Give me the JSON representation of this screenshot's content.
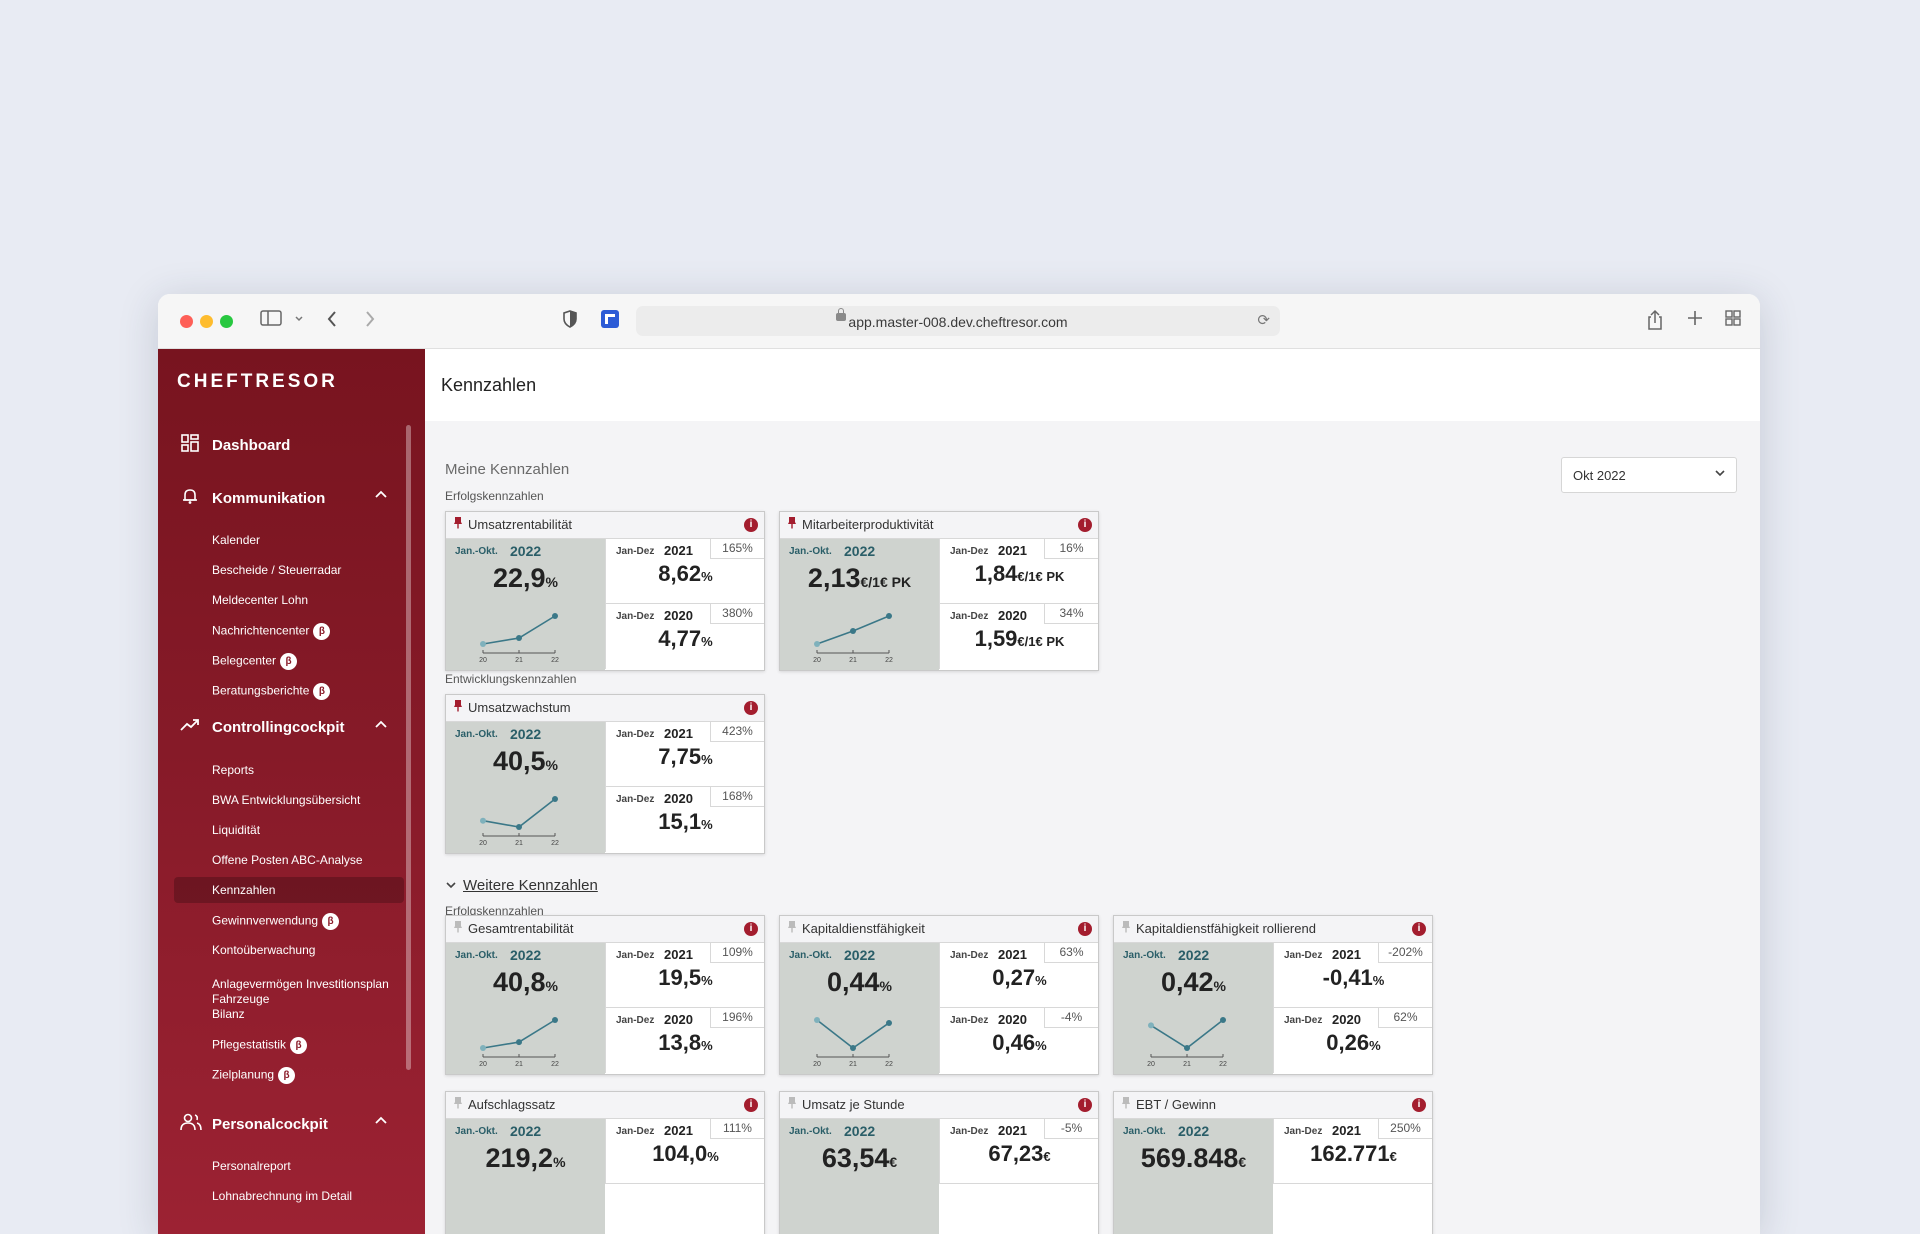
{
  "browser": {
    "url": "app.master-008.dev.cheftresor.com"
  },
  "sidebar": {
    "logo": "CHEFTRESOR",
    "dashboard": "Dashboard",
    "sections": [
      {
        "label": "Kommunikation",
        "items": [
          {
            "label": "Kalender"
          },
          {
            "label": "Bescheide / Steuerradar"
          },
          {
            "label": "Meldecenter Lohn"
          },
          {
            "label": "Nachrichtencenter",
            "beta": "β"
          },
          {
            "label": "Belegcenter",
            "beta": "β"
          },
          {
            "label": "Beratungsberichte",
            "beta": "β"
          }
        ]
      },
      {
        "label": "Controllingcockpit",
        "items": [
          {
            "label": "Reports"
          },
          {
            "label": "BWA  Entwicklungsübersicht"
          },
          {
            "label": "Liquidität"
          },
          {
            "label": "Offene Posten ABC-Analyse"
          },
          {
            "label": "Kennzahlen",
            "active": true
          },
          {
            "label": "Gewinnverwendung",
            "beta": "β"
          },
          {
            "label": "Kontoüberwachung"
          },
          {
            "label": "Anlagevermögen Investitionsplan Fahrzeuge"
          },
          {
            "label": "Bilanz"
          },
          {
            "label": "Pflegestatistik",
            "beta": "β"
          },
          {
            "label": "Zielplanung",
            "beta": "β"
          }
        ]
      },
      {
        "label": "Personalcockpit",
        "items": [
          {
            "label": "Personalreport"
          },
          {
            "label": "Lohnabrechnung im Detail"
          }
        ]
      }
    ]
  },
  "page": {
    "title": "Kennzahlen",
    "my_kpis_title": "Meine Kennzahlen",
    "group_success": "Erfolgskennzahlen",
    "group_development": "Entwicklungskennzahlen",
    "more_kpis": "Weitere Kennzahlen",
    "group_success_more": "Erfolgskennzahlen",
    "period_select": {
      "value": "Okt 2022"
    }
  },
  "cards": [
    {
      "title": "Umsatzrentabilität",
      "pinned": true,
      "period": "Jan.-Okt.",
      "year": "2022",
      "value": "22,9",
      "unit": "%",
      "cmp": [
        {
          "period": "Jan-Dez",
          "year": "2021",
          "value": "8,62",
          "unit": "%",
          "pct": "165%"
        },
        {
          "period": "Jan-Dez",
          "year": "2020",
          "value": "4,77",
          "unit": "%",
          "pct": "380%"
        }
      ],
      "spark": [
        4.77,
        8.62,
        22.9
      ],
      "spark_labels": [
        "20",
        "21",
        "22"
      ]
    },
    {
      "title": "Mitarbeiterproduktivität",
      "pinned": true,
      "period": "Jan.-Okt.",
      "year": "2022",
      "value": "2,13",
      "unit": "€/1€ PK",
      "cmp": [
        {
          "period": "Jan-Dez",
          "year": "2021",
          "value": "1,84",
          "unit": "€/1€ PK",
          "pct": "16%"
        },
        {
          "period": "Jan-Dez",
          "year": "2020",
          "value": "1,59",
          "unit": "€/1€ PK",
          "pct": "34%"
        }
      ],
      "spark": [
        1.59,
        1.84,
        2.13
      ],
      "spark_labels": [
        "20",
        "21",
        "22"
      ]
    },
    {
      "title": "Umsatzwachstum",
      "pinned": true,
      "period": "Jan.-Okt.",
      "year": "2022",
      "value": "40,5",
      "unit": "%",
      "cmp": [
        {
          "period": "Jan-Dez",
          "year": "2021",
          "value": "7,75",
          "unit": "%",
          "pct": "423%"
        },
        {
          "period": "Jan-Dez",
          "year": "2020",
          "value": "15,1",
          "unit": "%",
          "pct": "168%"
        }
      ],
      "spark": [
        15.1,
        7.75,
        40.5
      ],
      "spark_labels": [
        "20",
        "21",
        "22"
      ]
    },
    {
      "title": "Gesamtrentabilität",
      "pinned": false,
      "period": "Jan.-Okt.",
      "year": "2022",
      "value": "40,8",
      "unit": "%",
      "cmp": [
        {
          "period": "Jan-Dez",
          "year": "2021",
          "value": "19,5",
          "unit": "%",
          "pct": "109%"
        },
        {
          "period": "Jan-Dez",
          "year": "2020",
          "value": "13,8",
          "unit": "%",
          "pct": "196%"
        }
      ],
      "spark": [
        13.8,
        19.5,
        40.8
      ],
      "spark_labels": [
        "20",
        "21",
        "22"
      ]
    },
    {
      "title": "Kapitaldienstfähigkeit",
      "pinned": false,
      "period": "Jan.-Okt.",
      "year": "2022",
      "value": "0,44",
      "unit": "%",
      "cmp": [
        {
          "period": "Jan-Dez",
          "year": "2021",
          "value": "0,27",
          "unit": "%",
          "pct": "63%"
        },
        {
          "period": "Jan-Dez",
          "year": "2020",
          "value": "0,46",
          "unit": "%",
          "pct": "-4%"
        }
      ],
      "spark": [
        0.46,
        0.27,
        0.44
      ],
      "spark_labels": [
        "20",
        "21",
        "22"
      ]
    },
    {
      "title": "Kapitaldienstfähigkeit rollierend",
      "pinned": false,
      "period": "Jan.-Okt.",
      "year": "2022",
      "value": "0,42",
      "unit": "%",
      "cmp": [
        {
          "period": "Jan-Dez",
          "year": "2021",
          "value": "-0,41",
          "unit": "%",
          "pct": "-202%"
        },
        {
          "period": "Jan-Dez",
          "year": "2020",
          "value": "0,26",
          "unit": "%",
          "pct": "62%"
        }
      ],
      "spark": [
        0.26,
        -0.41,
        0.42
      ],
      "spark_labels": [
        "20",
        "21",
        "22"
      ]
    },
    {
      "title": "Aufschlagssatz",
      "pinned": false,
      "period": "Jan.-Okt.",
      "year": "2022",
      "value": "219,2",
      "unit": "%",
      "cmp": [
        {
          "period": "Jan-Dez",
          "year": "2021",
          "value": "104,0",
          "unit": "%",
          "pct": "111%"
        }
      ],
      "spark": [],
      "spark_labels": []
    },
    {
      "title": "Umsatz je Stunde",
      "pinned": false,
      "period": "Jan.-Okt.",
      "year": "2022",
      "value": "63,54",
      "unit": "€",
      "cmp": [
        {
          "period": "Jan-Dez",
          "year": "2021",
          "value": "67,23",
          "unit": "€",
          "pct": "-5%"
        }
      ],
      "spark": [],
      "spark_labels": []
    },
    {
      "title": "EBT / Gewinn",
      "pinned": false,
      "period": "Jan.-Okt.",
      "year": "2022",
      "value": "569.848",
      "unit": "€",
      "cmp": [
        {
          "period": "Jan-Dez",
          "year": "2021",
          "value": "162.771",
          "unit": "€",
          "pct": "250%"
        }
      ],
      "spark": [],
      "spark_labels": []
    }
  ],
  "colors": {
    "accent": "#a31d2e",
    "sidebar": "#861a28",
    "kpi_teal": "#2a5e68",
    "spark_line": "#3b7888",
    "card_main_bg": "#cfd3cf"
  }
}
